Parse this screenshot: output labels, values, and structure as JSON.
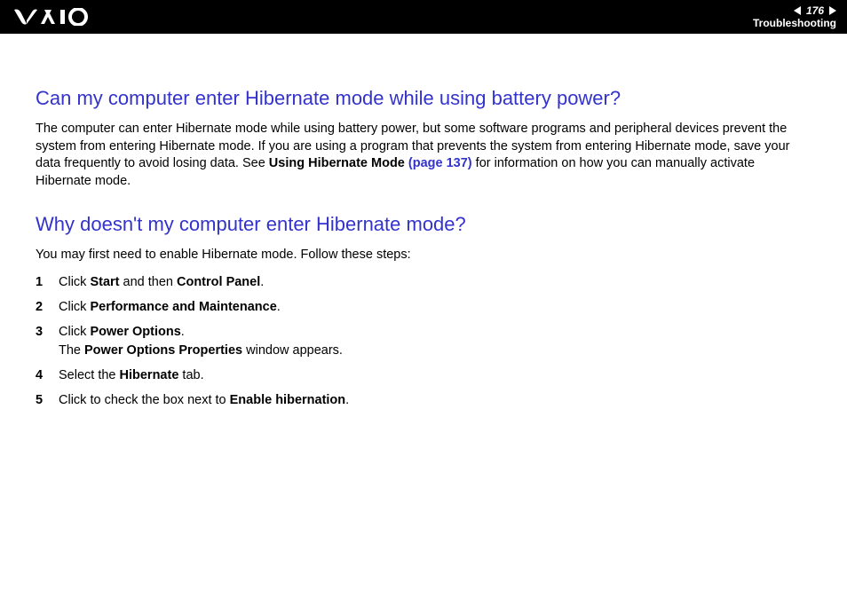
{
  "header": {
    "page_number": "176",
    "section": "Troubleshooting"
  },
  "section1": {
    "heading": "Can my computer enter Hibernate mode while using battery power?",
    "para_pre": "The computer can enter Hibernate mode while using battery power, but some software programs and peripheral devices prevent the system from entering Hibernate mode. If you are using a program that prevents the system from entering Hibernate mode, save your data frequently to avoid losing data. See ",
    "para_link_bold": "Using Hibernate Mode ",
    "para_link_page": "(page 137)",
    "para_post": " for information on how you can manually activate Hibernate mode."
  },
  "section2": {
    "heading": "Why doesn't my computer enter Hibernate mode?",
    "intro": "You may first need to enable Hibernate mode. Follow these steps:",
    "steps": [
      {
        "n": "1",
        "pre": "Click ",
        "b1": "Start",
        "mid": " and then ",
        "b2": "Control Panel",
        "post": "."
      },
      {
        "n": "2",
        "pre": "Click ",
        "b1": "Performance and Maintenance",
        "post": "."
      },
      {
        "n": "3",
        "pre": "Click ",
        "b1": "Power Options",
        "post": ".",
        "line2_pre": "The ",
        "line2_b": "Power Options Properties",
        "line2_post": " window appears."
      },
      {
        "n": "4",
        "pre": "Select the ",
        "b1": "Hibernate",
        "post": " tab."
      },
      {
        "n": "5",
        "pre": "Click to check the box next to ",
        "b1": "Enable hibernation",
        "post": "."
      }
    ]
  }
}
